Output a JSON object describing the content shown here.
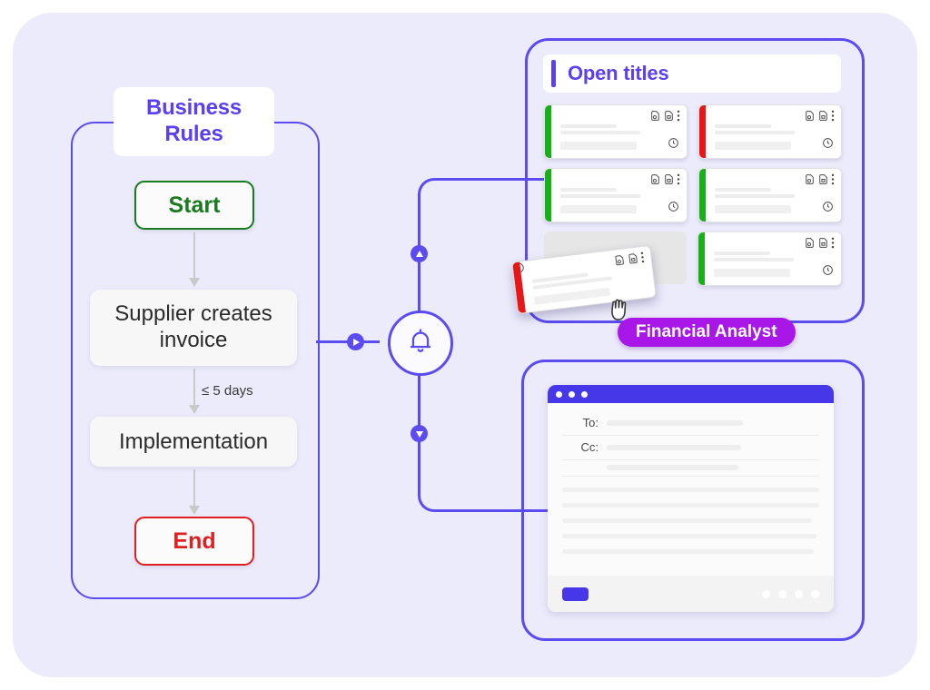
{
  "flow": {
    "panel_title": "Business\nRules",
    "title_line1": "Business",
    "title_line2": "Rules",
    "start_label": "Start",
    "process_1": "Supplier creates invoice",
    "edge_label": "≤ 5 days",
    "process_2": "Implementation",
    "end_label": "End",
    "colors": {
      "start": "#1a7a1f",
      "end": "#e02020",
      "border": "#5b4bf0",
      "title_text": "#5b3ff0"
    }
  },
  "hub": {
    "icon": "bell-icon",
    "connector_color": "#5b4bf0",
    "dots": [
      {
        "name": "connector-dot-right",
        "direction": "right"
      },
      {
        "name": "connector-dot-up",
        "direction": "up"
      },
      {
        "name": "connector-dot-down",
        "direction": "down"
      }
    ]
  },
  "titles_panel": {
    "header": "Open titles",
    "accent": "#5b3ff0",
    "card_icons": {
      "doc_check": "document-check-icon",
      "doc_lock": "document-lock-icon",
      "more": "more-vertical-icon",
      "clock": "clock-icon"
    },
    "rows": [
      [
        {
          "name": "title-card",
          "status_color": "#18b018",
          "state": "card"
        },
        {
          "name": "title-card",
          "status_color": "#e81616",
          "state": "card"
        }
      ],
      [
        {
          "name": "title-card",
          "status_color": "#18b018",
          "state": "card"
        },
        {
          "name": "title-card",
          "status_color": "#18b018",
          "state": "card"
        }
      ],
      [
        {
          "name": "drop-placeholder",
          "status_color": "#e6e6e6",
          "state": "empty"
        },
        {
          "name": "title-card",
          "status_color": "#18b018",
          "state": "card"
        }
      ]
    ],
    "dragged_card": {
      "name": "dragged-title-card",
      "status_color": "#e81616",
      "cursor": "grabbing-hand-cursor"
    },
    "badge": {
      "label": "Financial Analyst",
      "color": "#a816e8",
      "text_color": "#ffffff"
    }
  },
  "mail_panel": {
    "window_chrome_color": "#4637e8",
    "traffic_dots": 3,
    "fields": [
      {
        "label": "To:",
        "value": ""
      },
      {
        "label": "Cc:",
        "value": ""
      },
      {
        "label": "",
        "value": ""
      }
    ],
    "body_line_count": 6,
    "send_button": {
      "name": "send-button",
      "color": "#4637e8",
      "label": ""
    },
    "footer_icon_count": 4
  },
  "canvas": {
    "background": "#ecebfb"
  }
}
